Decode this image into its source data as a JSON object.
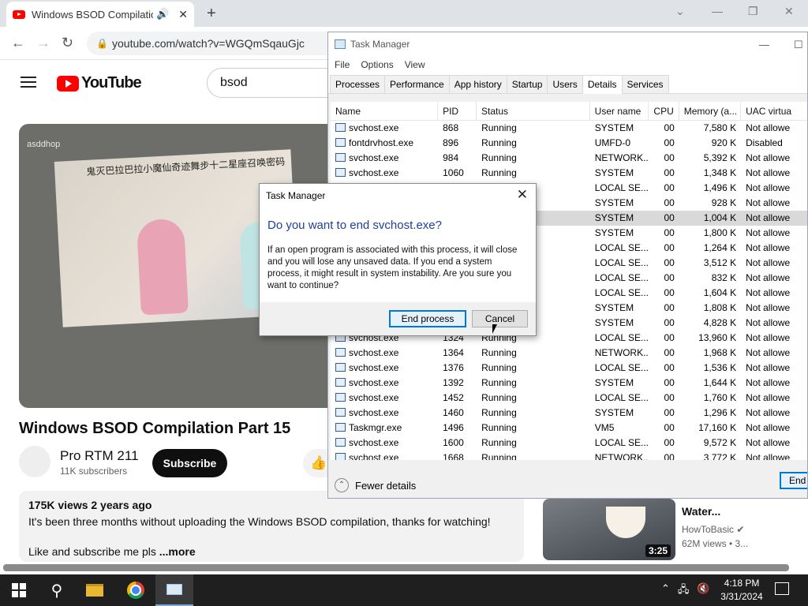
{
  "browser": {
    "tab_title": "Windows BSOD Compilation",
    "new_tab": "+",
    "url": "youtube.com/watch?v=WGQmSqauGjc"
  },
  "youtube": {
    "logo_text": "YouTube",
    "search_value": "bsod",
    "video_caption": "鬼灭巴拉巴拉小魔仙奇迹舞步十二星座召唤密码",
    "video_watermark": "asddhop",
    "video_title": "Windows BSOD Compilation Part 15",
    "channel_name": "Pro RTM 211",
    "channel_subs": "11K subscribers",
    "subscribe_label": "Subscribe",
    "desc_views": "175K views  2 years ago",
    "desc_line1": "It's been three months without uploading the Windows BSOD compilation, thanks for watching!",
    "desc_line2": "Like and subscribe me pls",
    "desc_more": "...more",
    "rec_title": "Water...",
    "rec_channel": "HowToBasic",
    "rec_views": "62M views  • 3...",
    "rec_duration": "3:25"
  },
  "task_manager": {
    "title": "Task Manager",
    "menu": [
      "File",
      "Options",
      "View"
    ],
    "tabs": [
      "Processes",
      "Performance",
      "App history",
      "Startup",
      "Users",
      "Details",
      "Services"
    ],
    "active_tab": "Details",
    "columns": [
      "Name",
      "PID",
      "Status",
      "User name",
      "CPU",
      "Memory (a...",
      "UAC virtua"
    ],
    "rows": [
      [
        "svchost.exe",
        "868",
        "Running",
        "SYSTEM",
        "00",
        "7,580 K",
        "Not allowe"
      ],
      [
        "fontdrvhost.exe",
        "896",
        "Running",
        "UMFD-0",
        "00",
        "920 K",
        "Disabled"
      ],
      [
        "svchost.exe",
        "984",
        "Running",
        "NETWORK...",
        "00",
        "5,392 K",
        "Not allowe"
      ],
      [
        "svchost.exe",
        "1060",
        "Running",
        "SYSTEM",
        "00",
        "1,348 K",
        "Not allowe"
      ],
      [
        "",
        "",
        "",
        "LOCAL SE...",
        "00",
        "1,496 K",
        "Not allowe"
      ],
      [
        "",
        "",
        "",
        "SYSTEM",
        "00",
        "928 K",
        "Not allowe"
      ],
      [
        "",
        "",
        "",
        "SYSTEM",
        "00",
        "1,004 K",
        "Not allowe"
      ],
      [
        "",
        "",
        "",
        "SYSTEM",
        "00",
        "1,800 K",
        "Not allowe"
      ],
      [
        "",
        "",
        "",
        "LOCAL SE...",
        "00",
        "1,264 K",
        "Not allowe"
      ],
      [
        "",
        "",
        "",
        "LOCAL SE...",
        "00",
        "3,512 K",
        "Not allowe"
      ],
      [
        "",
        "",
        "",
        "LOCAL SE...",
        "00",
        "832 K",
        "Not allowe"
      ],
      [
        "",
        "",
        "",
        "LOCAL SE...",
        "00",
        "1,604 K",
        "Not allowe"
      ],
      [
        "",
        "",
        "",
        "SYSTEM",
        "00",
        "1,808 K",
        "Not allowe"
      ],
      [
        "",
        "",
        "",
        "SYSTEM",
        "00",
        "4,828 K",
        "Not allowe"
      ],
      [
        "svchost.exe",
        "1324",
        "Running",
        "LOCAL SE...",
        "00",
        "13,960 K",
        "Not allowe"
      ],
      [
        "svchost.exe",
        "1364",
        "Running",
        "NETWORK...",
        "00",
        "1,968 K",
        "Not allowe"
      ],
      [
        "svchost.exe",
        "1376",
        "Running",
        "LOCAL SE...",
        "00",
        "1,536 K",
        "Not allowe"
      ],
      [
        "svchost.exe",
        "1392",
        "Running",
        "SYSTEM",
        "00",
        "1,644 K",
        "Not allowe"
      ],
      [
        "svchost.exe",
        "1452",
        "Running",
        "LOCAL SE...",
        "00",
        "1,760 K",
        "Not allowe"
      ],
      [
        "svchost.exe",
        "1460",
        "Running",
        "SYSTEM",
        "00",
        "1,296 K",
        "Not allowe"
      ],
      [
        "Taskmgr.exe",
        "1496",
        "Running",
        "VM5",
        "00",
        "17,160 K",
        "Not allowe"
      ],
      [
        "svchost.exe",
        "1600",
        "Running",
        "LOCAL SE...",
        "00",
        "9,572 K",
        "Not allowe"
      ],
      [
        "svchost.exe",
        "1668",
        "Running",
        "NETWORK...",
        "00",
        "3,772 K",
        "Not allowe"
      ]
    ],
    "selected_row": 6,
    "fewer_details": "Fewer details",
    "end_task": "End"
  },
  "dialog": {
    "title": "Task Manager",
    "question": "Do you want to end svchost.exe?",
    "message": "If an open program is associated with this process, it will close and you will lose any unsaved data. If you end a system process, it might result in system instability. Are you sure you want to continue?",
    "end_process": "End process",
    "cancel": "Cancel"
  },
  "taskbar": {
    "time": "4:18 PM",
    "date": "3/31/2024"
  }
}
